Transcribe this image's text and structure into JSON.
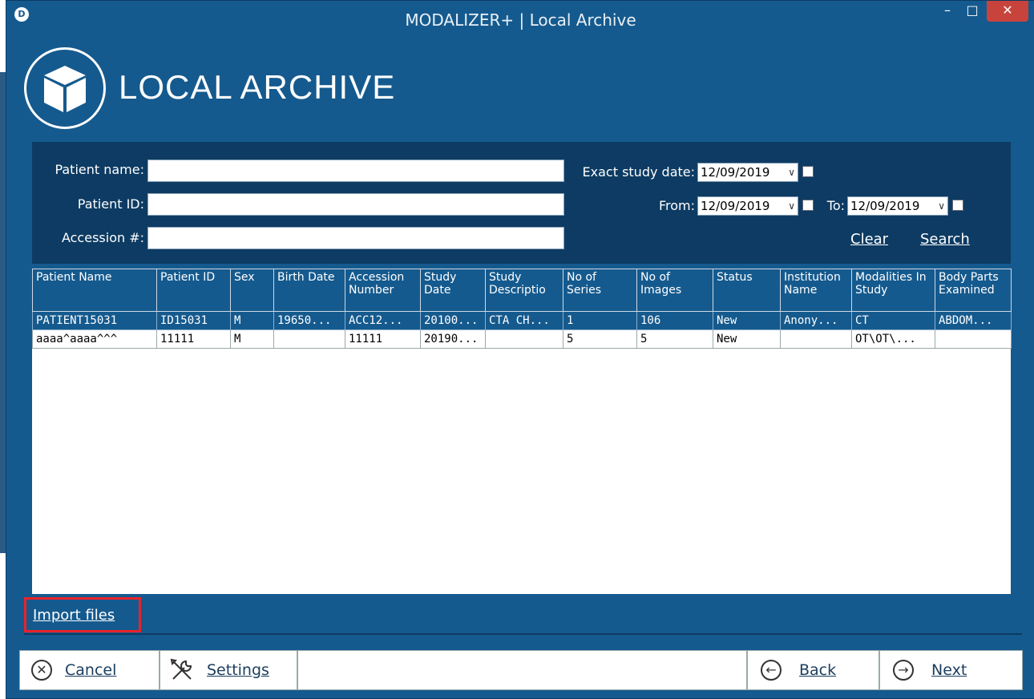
{
  "window": {
    "title": "MODALIZER+ | Local Archive",
    "app_icon_letter": "D"
  },
  "header": {
    "title": "LOCAL ARCHIVE"
  },
  "filters": {
    "patient_name_label": "Patient name:",
    "patient_id_label": "Patient ID:",
    "accession_label": "Accession #:",
    "patient_name_value": "",
    "patient_id_value": "",
    "accession_value": "",
    "exact_date_label": "Exact study date:",
    "exact_date_value": "12/09/2019",
    "from_label": "From:",
    "from_value": "12/09/2019",
    "to_label": "To:",
    "to_value": "12/09/2019",
    "clear_label": "Clear",
    "search_label": "Search"
  },
  "table": {
    "columns": [
      "Patient Name",
      "Patient ID",
      "Sex",
      "Birth Date",
      "Accession Number",
      "Study Date",
      "Study Descriptio",
      "No of Series",
      "No of Images",
      "Status",
      "Institution Name",
      "Modalities In Study",
      "Body Parts Examined"
    ],
    "rows": [
      [
        "PATIENT15031",
        "ID15031",
        "M",
        "19650...",
        "ACC12...",
        "20100...",
        "CTA CH...",
        "1",
        "106",
        "New",
        "Anony...",
        "CT",
        "ABDOM..."
      ],
      [
        "aaaa^aaaa^^^",
        "11111",
        "M",
        "",
        "11111",
        "20190...",
        "",
        "5",
        "5",
        "New",
        "",
        "OT\\OT\\...",
        ""
      ]
    ]
  },
  "import_label": "Import files",
  "buttons": {
    "cancel": "Cancel",
    "settings": "Settings",
    "back": "Back",
    "next": "Next"
  }
}
